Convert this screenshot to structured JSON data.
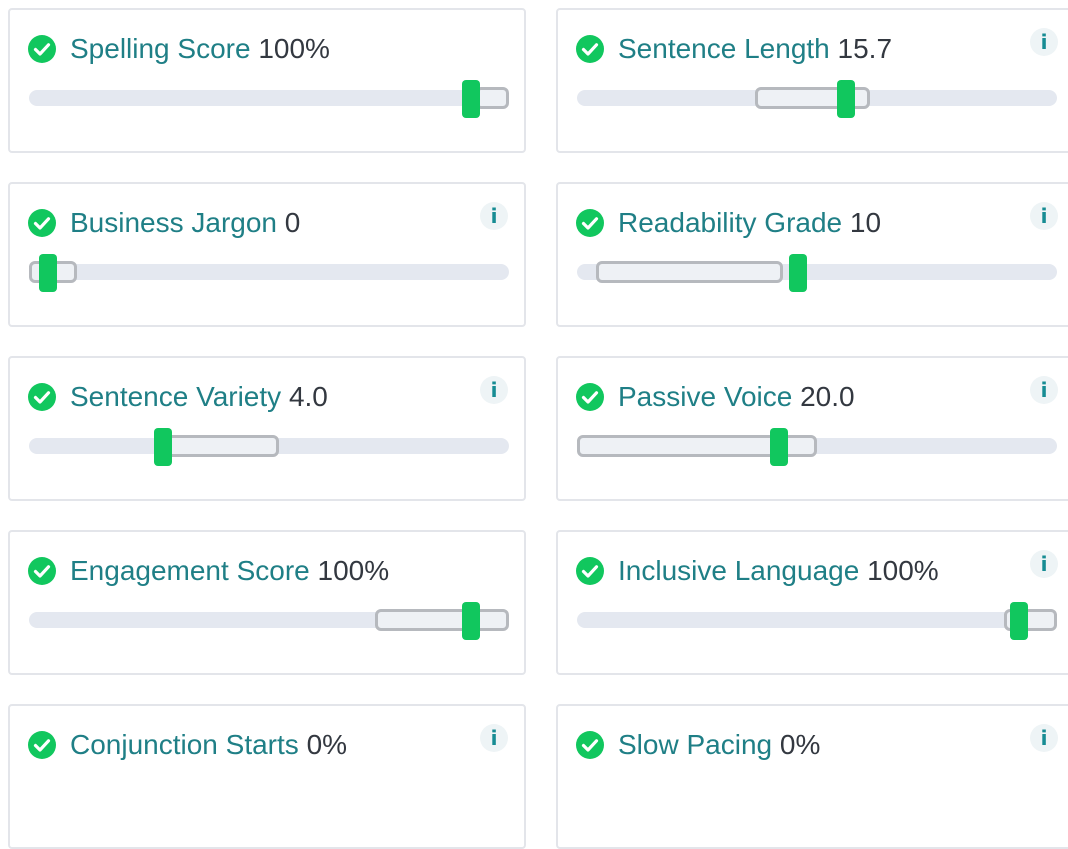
{
  "accent_color": "#11c75e",
  "label_color": "#1f7f86",
  "value_color": "#333840",
  "metrics": [
    {
      "name": "Spelling Score",
      "value": "100%",
      "status_icon": "check-circle-icon",
      "info_icon": false,
      "target_range": [
        0.93,
        1.0
      ],
      "level": 0.92
    },
    {
      "name": "Sentence Length",
      "value": "15.7",
      "status_icon": "check-circle-icon",
      "info_icon": "i",
      "target_range": [
        0.37,
        0.61
      ],
      "level": 0.56
    },
    {
      "name": "Business Jargon",
      "value": "0",
      "status_icon": "check-circle-icon",
      "info_icon": "i",
      "target_range": [
        0.0,
        0.1
      ],
      "level": 0.04
    },
    {
      "name": "Readability Grade",
      "value": "10",
      "status_icon": "check-circle-icon",
      "info_icon": "i",
      "target_range": [
        0.04,
        0.43
      ],
      "level": 0.46
    },
    {
      "name": "Sentence Variety",
      "value": "4.0",
      "status_icon": "check-circle-icon",
      "info_icon": "i",
      "target_range": [
        0.28,
        0.52
      ],
      "level": 0.28
    },
    {
      "name": "Passive Voice",
      "value": "20.0",
      "status_icon": "check-circle-icon",
      "info_icon": "i",
      "target_range": [
        0.0,
        0.5
      ],
      "level": 0.42
    },
    {
      "name": "Engagement Score",
      "value": "100%",
      "status_icon": "check-circle-icon",
      "info_icon": false,
      "target_range": [
        0.72,
        1.0
      ],
      "level": 0.92
    },
    {
      "name": "Inclusive Language",
      "value": "100%",
      "status_icon": "check-circle-icon",
      "info_icon": "i",
      "target_range": [
        0.89,
        1.0
      ],
      "level": 0.92
    },
    {
      "name": "Conjunction Starts",
      "value": "0%",
      "status_icon": "check-circle-icon",
      "info_icon": "i",
      "target_range": null,
      "level": null
    },
    {
      "name": "Slow Pacing",
      "value": "0%",
      "status_icon": "check-circle-icon",
      "info_icon": "i",
      "target_range": null,
      "level": null
    }
  ]
}
